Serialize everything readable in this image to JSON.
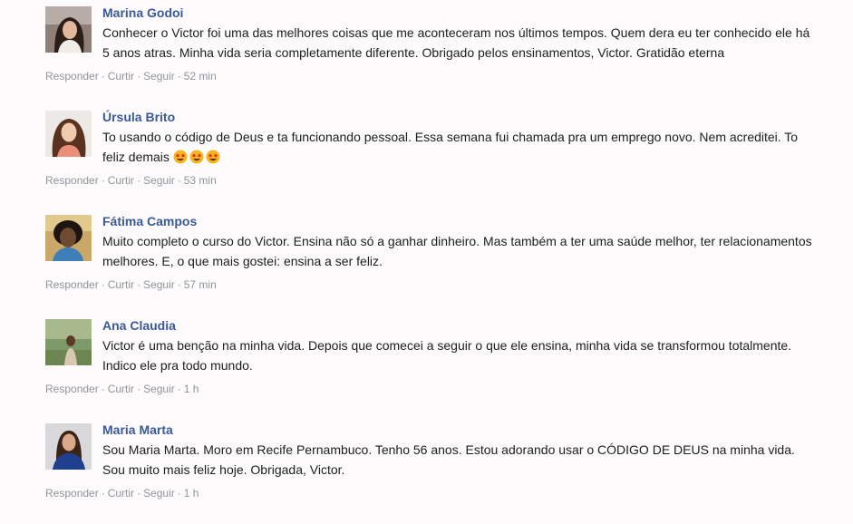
{
  "actions": {
    "reply": "Responder",
    "like": "Curtir",
    "follow": "Seguir",
    "separator": "·"
  },
  "comments": [
    {
      "author": "Marina Godoi",
      "text": "Conhecer o Victor foi uma das melhores coisas que me aconteceram nos últimos tempos. Quem dera eu ter conhecido ele há 5 anos atras. Minha vida seria completamente diferente. Obrigado pelos ensinamentos, Victor. Gratidão eterna",
      "time": "52 min"
    },
    {
      "author": "Úrsula Brito",
      "text": "To usando o código de Deus e ta funcionando pessoal. Essa semana fui chamada pra um emprego novo. Nem acreditei. To feliz demais",
      "emoji": "star-struck-emoji",
      "time": "53 min"
    },
    {
      "author": "Fátima Campos",
      "text": "Muito completo o curso do Victor. Ensina não só a ganhar dinheiro. Mas também a ter uma saúde melhor, ter relacionamentos melhores. E, o que mais gostei: ensina a ser feliz.",
      "time": "57 min"
    },
    {
      "author": "Ana Claudia",
      "text": "Victor é uma benção na minha vida. Depois que comecei a seguir o que ele ensina, minha vida se transformou totalmente. Indico ele pra todo mundo.",
      "time": "1 h"
    },
    {
      "author": "Maria Marta",
      "text": "Sou Maria Marta. Moro em Recife Pernambuco. Tenho 56 anos. Estou adorando usar o CÓDIGO DE DEUS na minha vida. Sou muito mais feliz hoje. Obrigada, Victor.",
      "time": "1 h"
    }
  ],
  "colors": {
    "author_link": "#3b5998",
    "meta_text": "#90949c",
    "body_text": "#1c1e21",
    "background": "#fdfbfb"
  }
}
